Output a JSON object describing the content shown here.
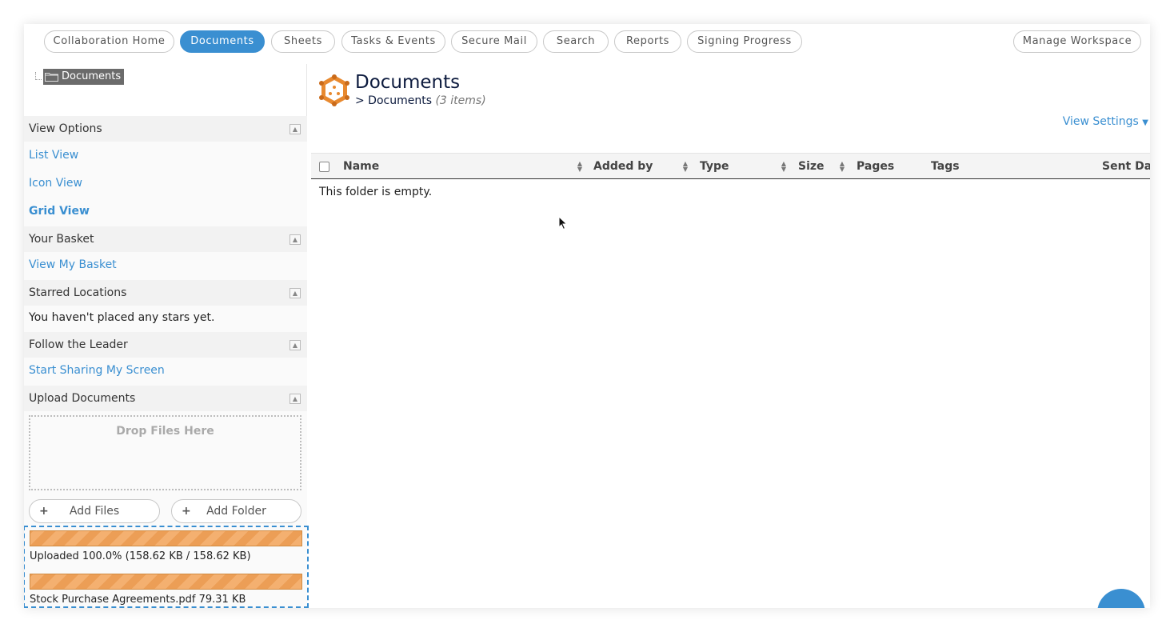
{
  "nav": {
    "tabs": [
      {
        "label": "Collaboration Home",
        "active": false
      },
      {
        "label": "Documents",
        "active": true
      },
      {
        "label": "Sheets",
        "active": false
      },
      {
        "label": "Tasks & Events",
        "active": false
      },
      {
        "label": "Secure Mail",
        "active": false
      },
      {
        "label": "Search",
        "active": false
      },
      {
        "label": "Reports",
        "active": false
      },
      {
        "label": "Signing Progress",
        "active": false
      }
    ],
    "manage_label": "Manage Workspace"
  },
  "tree": {
    "root_label": "Documents",
    "icon": "folder-icon"
  },
  "sidebar": {
    "view_options": {
      "title": "View Options",
      "items": [
        "List View",
        "Icon View",
        "Grid View"
      ],
      "selected": "Grid View"
    },
    "basket": {
      "title": "Your Basket",
      "link": "View My Basket"
    },
    "starred": {
      "title": "Starred Locations",
      "message": "You haven't placed any stars yet."
    },
    "follow": {
      "title": "Follow the Leader",
      "link": "Start Sharing My Screen"
    },
    "upload": {
      "title": "Upload Documents",
      "drop_label": "Drop Files Here",
      "add_files": "Add Files",
      "add_folder": "Add Folder",
      "progress_text": "Uploaded 100.0% (158.62 KB / 158.62 KB)",
      "progress_fraction": 1.0,
      "file_text": "Stock Purchase Agreements.pdf 79.31 KB",
      "file_fraction": 1.0
    }
  },
  "main": {
    "title": "Documents",
    "breadcrumb": "> Documents",
    "item_count": "(3 items)",
    "view_settings": "View Settings",
    "columns": [
      "Name",
      "Added by",
      "Type",
      "Size",
      "Pages",
      "Tags",
      "Sent Da"
    ],
    "empty_message": "This folder is empty."
  },
  "colors": {
    "accent": "#3a8fd1",
    "progress": "#ec9e56",
    "logo": "#e8892f"
  }
}
